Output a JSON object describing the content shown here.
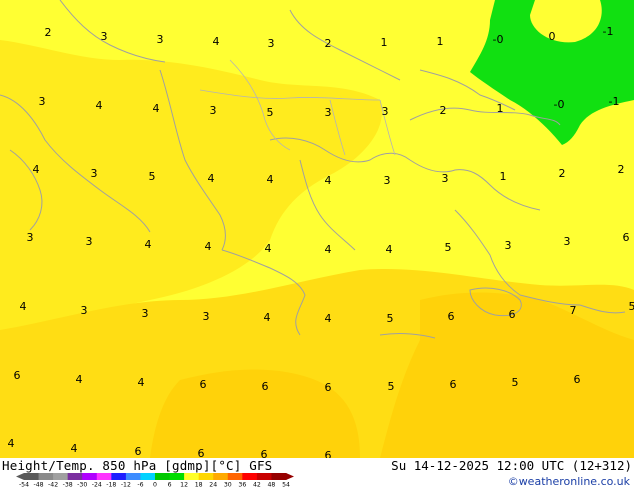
{
  "header": {
    "title": "Height/Temp. 850 hPa [gdmp][°C] GFS",
    "datetime": "Su 14-12-2025 12:00 UTC (12+312)",
    "credit": "©weatheronline.co.uk"
  },
  "map": {
    "labels": [
      {
        "text": "2"
      },
      {
        "text": "3"
      },
      {
        "text": "3"
      },
      {
        "text": "4"
      },
      {
        "text": "3"
      },
      {
        "text": "2"
      },
      {
        "text": "1"
      },
      {
        "text": "1"
      },
      {
        "text": "-0"
      },
      {
        "text": "0"
      },
      {
        "text": "-1"
      },
      {
        "text": "3"
      },
      {
        "text": "4"
      },
      {
        "text": "4"
      },
      {
        "text": "3"
      },
      {
        "text": "5"
      },
      {
        "text": "3"
      },
      {
        "text": "3"
      },
      {
        "text": "2"
      },
      {
        "text": "1"
      },
      {
        "text": "-0"
      },
      {
        "text": "-1"
      },
      {
        "text": "4"
      },
      {
        "text": "3"
      },
      {
        "text": "5"
      },
      {
        "text": "4"
      },
      {
        "text": "4"
      },
      {
        "text": "4"
      },
      {
        "text": "3"
      },
      {
        "text": "3"
      },
      {
        "text": "1"
      },
      {
        "text": "2"
      },
      {
        "text": "2"
      },
      {
        "text": "3"
      },
      {
        "text": "3"
      },
      {
        "text": "4"
      },
      {
        "text": "4"
      },
      {
        "text": "4"
      },
      {
        "text": "4"
      },
      {
        "text": "4"
      },
      {
        "text": "5"
      },
      {
        "text": "3"
      },
      {
        "text": "3"
      },
      {
        "text": "6"
      },
      {
        "text": "4"
      },
      {
        "text": "3"
      },
      {
        "text": "3"
      },
      {
        "text": "3"
      },
      {
        "text": "4"
      },
      {
        "text": "4"
      },
      {
        "text": "5"
      },
      {
        "text": "6"
      },
      {
        "text": "6"
      },
      {
        "text": "7"
      },
      {
        "text": "5"
      },
      {
        "text": "6"
      },
      {
        "text": "4"
      },
      {
        "text": "4"
      },
      {
        "text": "6"
      },
      {
        "text": "6"
      },
      {
        "text": "6"
      },
      {
        "text": "5"
      },
      {
        "text": "6"
      },
      {
        "text": "5"
      },
      {
        "text": "6"
      },
      {
        "text": "4"
      },
      {
        "text": "4"
      },
      {
        "text": "6"
      },
      {
        "text": "6"
      },
      {
        "text": "6"
      },
      {
        "text": "6"
      }
    ]
  },
  "colorbar": {
    "ticks": [
      "-54",
      "-48",
      "-42",
      "-38",
      "-30",
      "-24",
      "-18",
      "-12",
      "-6",
      "0",
      "6",
      "12",
      "18",
      "24",
      "30",
      "36",
      "42",
      "48",
      "54"
    ],
    "colors": [
      "#5a5a5a",
      "#8a8a8a",
      "#a0a0a0",
      "#7b2fa0",
      "#b000ff",
      "#ff33ff",
      "#1e1eff",
      "#3c8cff",
      "#00d2ff",
      "#00c800",
      "#00dc00",
      "#ffff28",
      "#ffd700",
      "#ffaa00",
      "#ff6400",
      "#ff0000",
      "#c80000",
      "#960000"
    ]
  }
}
